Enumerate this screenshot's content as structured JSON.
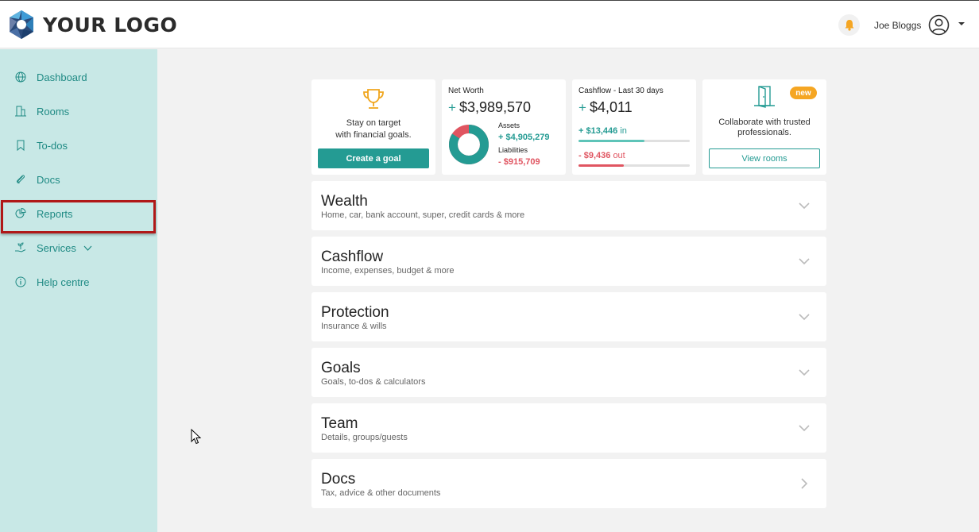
{
  "header": {
    "logo_text": "YOUR LOGO",
    "user_name": "Joe Bloggs",
    "icons": [
      "bell-icon",
      "user-avatar-icon",
      "caret-down-icon"
    ]
  },
  "sidebar": {
    "items": [
      {
        "label": "Dashboard",
        "icon": "globe-icon"
      },
      {
        "label": "Rooms",
        "icon": "building-icon"
      },
      {
        "label": "To-dos",
        "icon": "bookmark-icon"
      },
      {
        "label": "Docs",
        "icon": "paperclip-icon"
      },
      {
        "label": "Reports",
        "icon": "pie-chart-icon",
        "highlighted": true
      },
      {
        "label": "Services",
        "icon": "hand-plant-icon",
        "has_submenu": true
      },
      {
        "label": "Help centre",
        "icon": "info-icon"
      }
    ]
  },
  "cards": {
    "goal": {
      "line1": "Stay on target",
      "line2": "with financial goals.",
      "button": "Create a goal"
    },
    "net_worth": {
      "title": "Net Worth",
      "plus": "+",
      "amount": "$3,989,570",
      "assets_label": "Assets",
      "assets_value": "+ $4,905,279",
      "liabilities_label": "Liabilities",
      "liabilities_value": "- $915,709",
      "assets_fraction": 0.84
    },
    "cashflow": {
      "title": "Cashflow - Last 30 days",
      "plus": "+",
      "amount": "$4,011",
      "in_value": "+ $13,446",
      "in_label": "in",
      "out_value": "- $9,436",
      "out_label": "out",
      "in_fraction": 0.59,
      "out_fraction": 0.41
    },
    "rooms": {
      "badge": "new",
      "line1": "Collaborate with trusted",
      "line2": "professionals.",
      "button": "View rooms"
    }
  },
  "sections": [
    {
      "title": "Wealth",
      "subtitle": "Home, car, bank account, super, credit cards & more",
      "icon": "chevron-down-icon"
    },
    {
      "title": "Cashflow",
      "subtitle": "Income, expenses, budget & more",
      "icon": "chevron-down-icon"
    },
    {
      "title": "Protection",
      "subtitle": "Insurance & wills",
      "icon": "chevron-down-icon"
    },
    {
      "title": "Goals",
      "subtitle": "Goals, to-dos & calculators",
      "icon": "chevron-down-icon"
    },
    {
      "title": "Team",
      "subtitle": "Details, groups/guests",
      "icon": "chevron-down-icon"
    },
    {
      "title": "Docs",
      "subtitle": "Tax, advice & other documents",
      "icon": "chevron-right-icon"
    }
  ],
  "colors": {
    "accent": "#249b93",
    "sidebar_bg": "#c8e8e6",
    "negative": "#e05561",
    "badge": "#f5a623",
    "highlight_border": "#b01818"
  }
}
